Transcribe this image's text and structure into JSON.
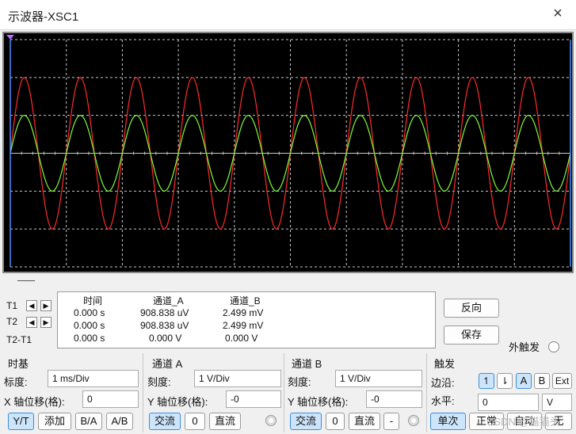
{
  "window": {
    "title": "示波器-XSC1",
    "close_icon": "×"
  },
  "scope": {
    "background": "#000000",
    "grid_color": "#c8c8c8",
    "channel_a_color": "#ff2b2b",
    "channel_b_color": "#7dff3a",
    "cycles_on_screen": 10,
    "channel_a_amplitude_div": 2,
    "channel_b_amplitude_div": 1
  },
  "measure": {
    "headers": {
      "time": "时间",
      "channel_a": "通道_A",
      "channel_b": "通道_B"
    },
    "t1": {
      "label": "T1",
      "time": "0.000 s",
      "a": "908.838 uV",
      "b": "2.499 mV"
    },
    "t2": {
      "label": "T2",
      "time": "0.000 s",
      "a": "908.838 uV",
      "b": "2.499 mV"
    },
    "diff": {
      "label": "T2-T1",
      "time": "0.000 s",
      "a": "0.000 V",
      "b": "0.000 V"
    },
    "reverse_label": "反向",
    "save_label": "保存",
    "ext_trigger_label": "外触发"
  },
  "timebase": {
    "title": "时基",
    "scale_label": "标度:",
    "scale_value": "1 ms/Div",
    "xpos_label": "X 轴位移(格):",
    "xpos_value": "0",
    "yt": "Y/T",
    "add": "添加",
    "ba": "B/A",
    "ab": "A/B"
  },
  "channel_a": {
    "title": "通道 A",
    "scale_label": "刻度:",
    "scale_value": "1  V/Div",
    "ypos_label": "Y 轴位移(格):",
    "ypos_value": "-0",
    "ac": "交流",
    "zero": "0",
    "dc": "直流"
  },
  "channel_b": {
    "title": "通道 B",
    "scale_label": "刻度:",
    "scale_value": "1  V/Div",
    "ypos_label": "Y 轴位移(格):",
    "ypos_value": "-0",
    "ac": "交流",
    "zero": "0",
    "dc": "直流",
    "minus": "-"
  },
  "trigger": {
    "title": "触发",
    "edge_label": "边沿:",
    "rising": "↿",
    "falling": "⇂",
    "a": "A",
    "b": "B",
    "ext": "Ext",
    "level_label": "水平:",
    "level_value": "0",
    "level_unit": "V",
    "single": "单次",
    "normal": "正常",
    "auto": "自动",
    "none": "无"
  },
  "watermark": "CSDN @猫猫头"
}
